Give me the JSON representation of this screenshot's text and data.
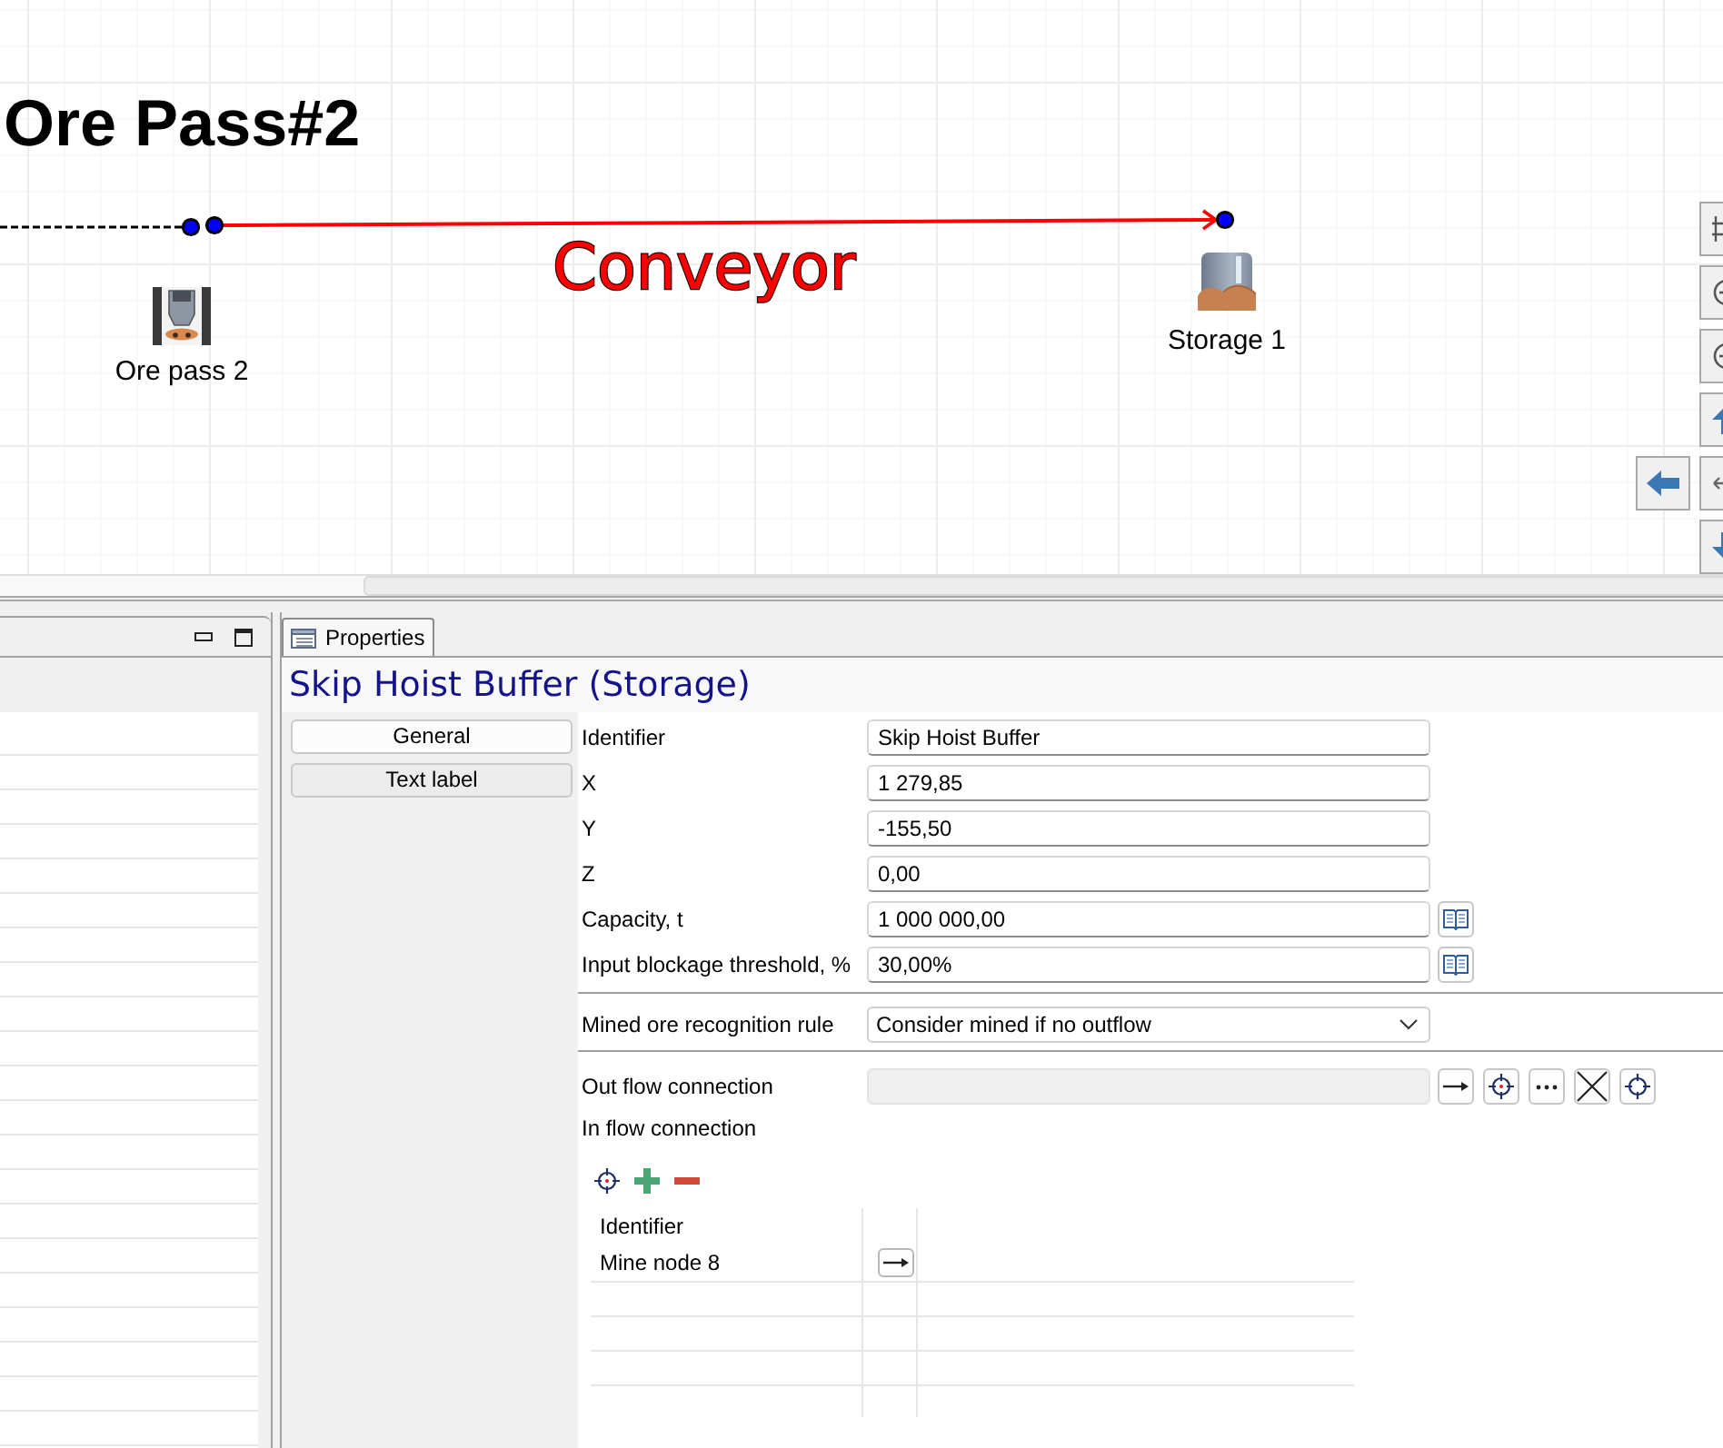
{
  "canvas": {
    "title": "Ore Pass#2",
    "connector_label": "Conveyor",
    "nodes": [
      {
        "kind": "ore_pass",
        "label": "Ore pass 2"
      },
      {
        "kind": "storage",
        "label": "Storage 1"
      }
    ]
  },
  "properties": {
    "tab": {
      "label": "Properties",
      "selected": true
    },
    "title": "Skip Hoist Buffer (Storage)",
    "sections": [
      {
        "label": "General",
        "selected": true
      },
      {
        "label": "Text label",
        "selected": false
      }
    ],
    "groups": [
      {
        "fields": [
          {
            "kind": "text",
            "label": "Identifier",
            "value": "Skip Hoist Buffer"
          },
          {
            "kind": "text",
            "label": "X",
            "value": "1 279,85"
          },
          {
            "kind": "text",
            "label": "Y",
            "value": "-155,50"
          },
          {
            "kind": "text",
            "label": "Z",
            "value": "0,00"
          },
          {
            "kind": "lookup",
            "label": "Capacity, t",
            "value": "1 000 000,00"
          },
          {
            "kind": "lookup",
            "label": "Input blockage threshold, %",
            "value": "30,00%"
          }
        ]
      },
      {
        "fields": [
          {
            "kind": "select",
            "label": "Mined ore recognition rule",
            "value": "Consider mined if no outflow"
          }
        ]
      },
      {
        "fields": [
          {
            "kind": "connection",
            "label": "Out flow connection",
            "disabled": true
          },
          {
            "kind": "list",
            "label": "In flow connection",
            "columns": [
              "Identifier"
            ],
            "rows": [
              {
                "cells": [
                  "Mine node 8"
                ]
              }
            ]
          }
        ]
      }
    ]
  }
}
